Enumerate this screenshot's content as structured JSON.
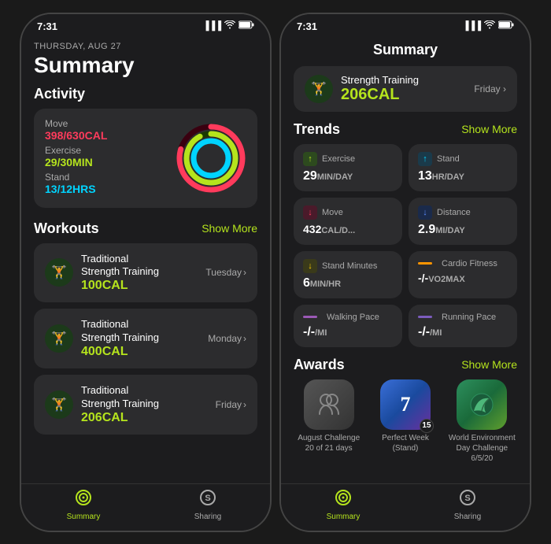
{
  "left_phone": {
    "status": {
      "time": "7:31",
      "time_arrow": "▲",
      "signal": "▐▐▐",
      "wifi": "wifi",
      "battery": "battery"
    },
    "date": "THURSDAY, AUG 27",
    "title": "Summary",
    "activity": {
      "section": "Activity",
      "move_label": "Move",
      "move_value": "398/630CAL",
      "exercise_label": "Exercise",
      "exercise_value": "29/30MIN",
      "stand_label": "Stand",
      "stand_value": "13/12HRS"
    },
    "workouts": {
      "section": "Workouts",
      "show_more": "Show More",
      "items": [
        {
          "name": "Traditional\nStrength Training",
          "cal": "100CAL",
          "day": "Tuesday"
        },
        {
          "name": "Traditional\nStrength Training",
          "cal": "400CAL",
          "day": "Monday"
        },
        {
          "name": "Traditional\nStrength Training",
          "cal": "206CAL",
          "day": "Friday"
        }
      ]
    },
    "tabs": [
      {
        "label": "Summary",
        "active": true
      },
      {
        "label": "Sharing",
        "active": false
      }
    ]
  },
  "right_phone": {
    "status": {
      "time": "7:31",
      "time_arrow": "▲"
    },
    "title": "Summary",
    "top_workout": {
      "name": "Strength Training",
      "cal": "206CAL",
      "day": "Friday"
    },
    "trends": {
      "section": "Trends",
      "show_more": "Show More",
      "items": [
        {
          "name": "Exercise",
          "value": "29MIN/DAY",
          "direction": "up",
          "color": "green"
        },
        {
          "name": "Stand",
          "value": "13HR/DAY",
          "direction": "up",
          "color": "cyan"
        },
        {
          "name": "Move",
          "value": "432CAL/D...",
          "direction": "down",
          "color": "red"
        },
        {
          "name": "Distance",
          "value": "2.9MI/DAY",
          "direction": "down",
          "color": "blue"
        },
        {
          "name": "Stand Minutes",
          "value": "6MIN/HR",
          "direction": "down",
          "color": "yellow"
        },
        {
          "name": "Cardio Fitness",
          "value": "-/-VO2MAX",
          "direction": "line",
          "color": "orange"
        },
        {
          "name": "Walking Pace",
          "value": "-/-/MI",
          "direction": "line",
          "color": "purple"
        },
        {
          "name": "Running Pace",
          "value": "-/-/MI",
          "direction": "line",
          "color": "purple2"
        }
      ]
    },
    "awards": {
      "section": "Awards",
      "show_more": "Show More",
      "items": [
        {
          "label": "August Challenge\n20 of 21 days",
          "type": "gray",
          "icon": "👥",
          "num": ""
        },
        {
          "label": "Perfect Week\n(Stand)",
          "type": "blue",
          "icon": "7",
          "num": "15"
        },
        {
          "label": "World Environment\nDay Challenge\n6/5/20",
          "type": "green",
          "icon": "🌿",
          "num": ""
        }
      ]
    },
    "tabs": [
      {
        "label": "Summary",
        "active": true
      },
      {
        "label": "Sharing",
        "active": false
      }
    ]
  }
}
